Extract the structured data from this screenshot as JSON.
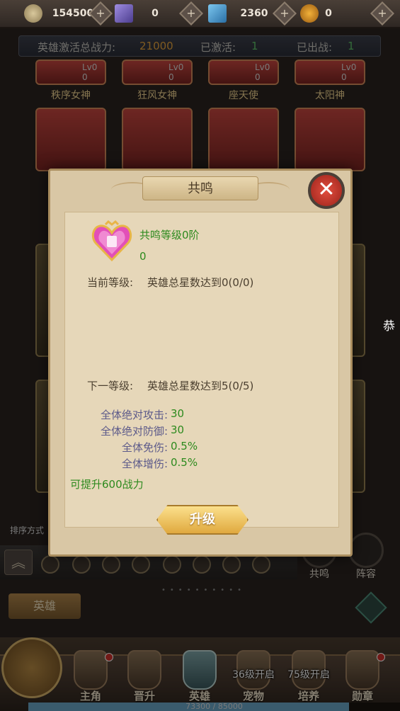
{
  "resources": [
    {
      "icon": "gold-coin-icon",
      "value": "154500",
      "color": "#b5a27a"
    },
    {
      "icon": "crystal-icon",
      "value": "0",
      "color": "#7a6bb8"
    },
    {
      "icon": "diamond-icon",
      "value": "2360",
      "color": "#3f91c9"
    },
    {
      "icon": "token-icon",
      "value": "0",
      "color": "#d08a1a"
    }
  ],
  "stats": {
    "power_label": "英雄激活总战力:",
    "power_value": "21000",
    "activated_label": "已激活:",
    "activated_value": "1",
    "deployed_label": "已出战:",
    "deployed_value": "1"
  },
  "heroes_top": [
    {
      "name": "秩序女神",
      "lv": "Lv0",
      "stars": "0"
    },
    {
      "name": "狂风女神",
      "lv": "Lv0",
      "stars": "0"
    },
    {
      "name": "座天使",
      "lv": "Lv0",
      "stars": "0"
    },
    {
      "name": "太阳神",
      "lv": "Lv0",
      "stars": "0"
    }
  ],
  "modal": {
    "title": "共鸣",
    "close": "✕",
    "resonance_level": "共鸣等级0阶",
    "resonance_value": "0",
    "current_label": "当前等级:",
    "current_req": "英雄总星数达到0(0/0)",
    "next_label": "下一等级:",
    "next_req": "英雄总星数达到5(0/5)",
    "bonuses": [
      {
        "label": "全体绝对攻击:",
        "value": "30"
      },
      {
        "label": "全体绝对防御:",
        "value": "30"
      },
      {
        "label": "全体免伤:",
        "value": "0.5%"
      },
      {
        "label": "全体增伤:",
        "value": "0.5%"
      }
    ],
    "power_gain": "可提升600战力",
    "upgrade_label": "升级"
  },
  "side_buttons": {
    "resonance": "共鸣",
    "lineup": "阵容"
  },
  "sort_label": "排序方式",
  "hero_tab": "英雄",
  "edge_text": "恭",
  "nav": [
    {
      "label": "主角",
      "lock": "",
      "dot": true
    },
    {
      "label": "晋升",
      "lock": "",
      "dot": false
    },
    {
      "label": "英雄",
      "lock": "",
      "dot": false,
      "active": true
    },
    {
      "label": "宠物",
      "lock": "36级开启",
      "dot": false
    },
    {
      "label": "培养",
      "lock": "75级开启",
      "dot": false
    },
    {
      "label": "勋章",
      "lock": "",
      "dot": true
    }
  ],
  "exp": {
    "text": "73300 / 85000",
    "fraction": 0.862
  }
}
